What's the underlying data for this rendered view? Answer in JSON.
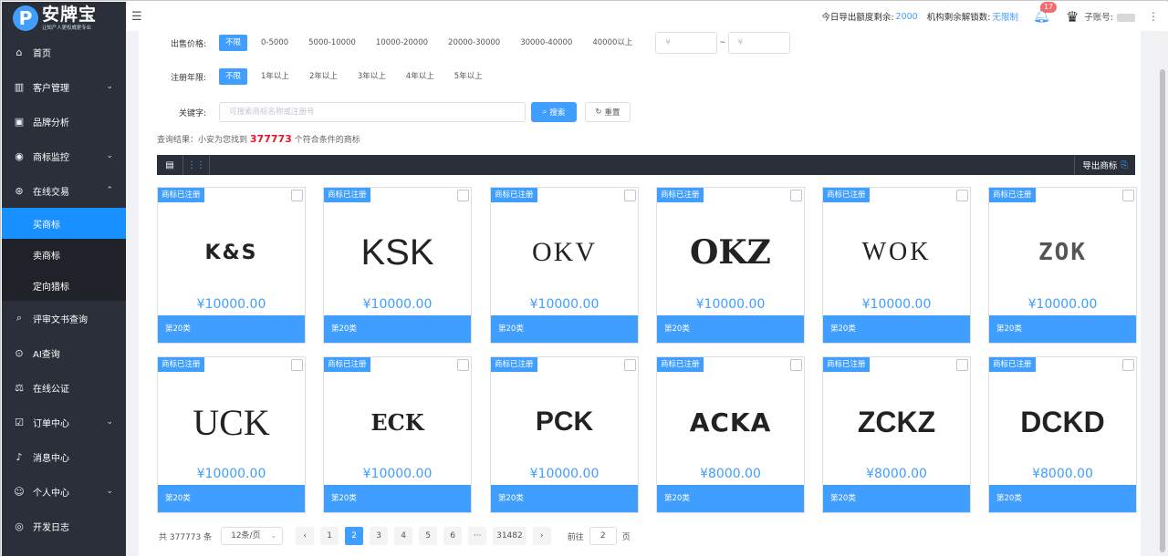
{
  "brand": {
    "logo_letter": "P",
    "title": "安牌宝",
    "subtitle": "让知产人更权威更专业"
  },
  "sidebar": {
    "items": [
      {
        "label": "首页",
        "icon": "home-icon",
        "glyph": "⌂"
      },
      {
        "label": "客户管理",
        "icon": "chart-bars-icon",
        "glyph": "▥",
        "chevron": "⌄"
      },
      {
        "label": "品牌分析",
        "icon": "monitor-icon",
        "glyph": "▣"
      },
      {
        "label": "商标监控",
        "icon": "camera-icon",
        "glyph": "◉",
        "chevron": "⌄"
      },
      {
        "label": "在线交易",
        "icon": "coin-icon",
        "glyph": "⊛",
        "chevron": "⌃"
      }
    ],
    "sub_items": [
      {
        "label": "买商标",
        "active": true
      },
      {
        "label": "卖商标",
        "active": false
      },
      {
        "label": "定向猎标",
        "active": false
      }
    ],
    "items_after": [
      {
        "label": "评审文书查询",
        "icon": "document-search-icon",
        "glyph": "⌕"
      },
      {
        "label": "AI查询",
        "icon": "ai-search-icon",
        "glyph": "⊙"
      },
      {
        "label": "在线公证",
        "icon": "scale-icon",
        "glyph": "⚖"
      },
      {
        "label": "订单中心",
        "icon": "order-icon",
        "glyph": "☑",
        "chevron": "⌄"
      },
      {
        "label": "消息中心",
        "icon": "bell-icon",
        "glyph": "♪"
      },
      {
        "label": "个人中心",
        "icon": "user-icon",
        "glyph": "☺",
        "chevron": "⌄"
      },
      {
        "label": "开发日志",
        "icon": "log-icon",
        "glyph": "◎"
      }
    ]
  },
  "topbar": {
    "quota_label": "今日导出额度剩余:",
    "quota_value": "2000",
    "unlock_label": "机构剩余解锁数:",
    "unlock_value": "无限制",
    "notification_count": "17",
    "account_label": "子账号:"
  },
  "filters": {
    "price_label": "出售价格:",
    "price_options": [
      "不限",
      "0-5000",
      "5000-10000",
      "10000-20000",
      "20000-30000",
      "30000-40000",
      "40000以上"
    ],
    "price_min_placeholder": "¥",
    "price_max_placeholder": "¥",
    "tilde": "~",
    "years_label": "注册年限:",
    "year_options": [
      "不限",
      "1年以上",
      "2年以上",
      "3年以上",
      "4年以上",
      "5年以上"
    ],
    "keyword_label": "关键字:",
    "keyword_placeholder": "可搜索商标名称或注册号",
    "search_label": "搜索",
    "reset_label": "重置"
  },
  "result": {
    "prefix": "查询结果：小安为您找到",
    "count": "377773",
    "suffix": "个符合条件的商标"
  },
  "toolbar": {
    "export_label": "导出商标"
  },
  "cards": [
    {
      "tag": "商标已注册",
      "mark": "K&S",
      "price": "¥10000.00",
      "class": "第20类"
    },
    {
      "tag": "商标已注册",
      "mark": "KSK",
      "price": "¥10000.00",
      "class": "第20类"
    },
    {
      "tag": "商标已注册",
      "mark": "OKV",
      "price": "¥10000.00",
      "class": "第20类"
    },
    {
      "tag": "商标已注册",
      "mark": "OKZ",
      "price": "¥10000.00",
      "class": "第20类"
    },
    {
      "tag": "商标已注册",
      "mark": "WOK",
      "price": "¥10000.00",
      "class": "第20类"
    },
    {
      "tag": "商标已注册",
      "mark": "ZOK",
      "price": "¥10000.00",
      "class": "第20类"
    },
    {
      "tag": "商标已注册",
      "mark": "UCK",
      "price": "¥10000.00",
      "class": "第20类"
    },
    {
      "tag": "商标已注册",
      "mark": "ECK",
      "price": "¥10000.00",
      "class": "第20类"
    },
    {
      "tag": "商标已注册",
      "mark": "PCK",
      "price": "¥10000.00",
      "class": "第20类"
    },
    {
      "tag": "商标已注册",
      "mark": "ACKA",
      "price": "¥8000.00",
      "class": "第20类"
    },
    {
      "tag": "商标已注册",
      "mark": "ZCKZ",
      "price": "¥8000.00",
      "class": "第20类"
    },
    {
      "tag": "商标已注册",
      "mark": "DCKD",
      "price": "¥8000.00",
      "class": "第20类"
    }
  ],
  "pagination": {
    "total": "共 377773 条",
    "page_size": "12条/页",
    "prev": "‹",
    "next": "›",
    "pages": [
      "1",
      "2",
      "3",
      "4",
      "5",
      "6",
      "···",
      "31482"
    ],
    "current": "2",
    "goto_label": "前往",
    "goto_value": "2",
    "goto_suffix": "页"
  },
  "colors": {
    "accent": "#409eff",
    "sidebar": "#2b2f3a",
    "count_red": "#e6162d"
  }
}
